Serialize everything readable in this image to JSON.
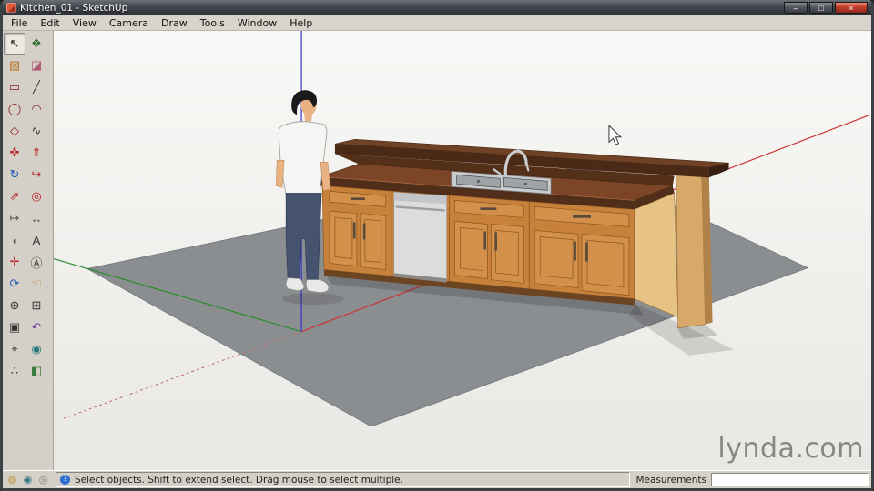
{
  "window": {
    "title": "Kitchen_01 - SketchUp",
    "controls": {
      "minimize_glyph": "–",
      "maximize_glyph": "□",
      "close_glyph": "×"
    }
  },
  "menu": {
    "items": [
      "File",
      "Edit",
      "View",
      "Camera",
      "Draw",
      "Tools",
      "Window",
      "Help"
    ]
  },
  "toolbar": {
    "tools": [
      {
        "id": "select",
        "label": "Select",
        "glyph": "↖",
        "color": "#1a1a1a",
        "active": true
      },
      {
        "id": "make-component",
        "label": "Make Component",
        "glyph": "❖",
        "color": "#2e6b2e",
        "active": false
      },
      {
        "id": "paint-bucket",
        "label": "Paint Bucket",
        "glyph": "▧",
        "color": "#b8762a",
        "active": false
      },
      {
        "id": "eraser",
        "label": "Eraser",
        "glyph": "◪",
        "color": "#b05a7a",
        "active": false
      },
      {
        "id": "rectangle",
        "label": "Rectangle",
        "glyph": "▭",
        "color": "#8a2222",
        "active": false
      },
      {
        "id": "line",
        "label": "Line",
        "glyph": "╱",
        "color": "#333333",
        "active": false
      },
      {
        "id": "circle",
        "label": "Circle",
        "glyph": "◯",
        "color": "#8a2222",
        "active": false
      },
      {
        "id": "arc",
        "label": "Arc",
        "glyph": "◠",
        "color": "#8a2222",
        "active": false
      },
      {
        "id": "polygon",
        "label": "Polygon",
        "glyph": "◇",
        "color": "#8a2222",
        "active": false
      },
      {
        "id": "freehand",
        "label": "Freehand",
        "glyph": "∿",
        "color": "#333333",
        "active": false
      },
      {
        "id": "move",
        "label": "Move",
        "glyph": "✜",
        "color": "#bb2222",
        "active": false
      },
      {
        "id": "push-pull",
        "label": "Push/Pull",
        "glyph": "⇑",
        "color": "#bb2222",
        "active": false
      },
      {
        "id": "rotate",
        "label": "Rotate",
        "glyph": "↻",
        "color": "#2255bb",
        "active": false
      },
      {
        "id": "follow-me",
        "label": "Follow Me",
        "glyph": "↪",
        "color": "#bb2222",
        "active": false
      },
      {
        "id": "scale",
        "label": "Scale",
        "glyph": "⇗",
        "color": "#bb2222",
        "active": false
      },
      {
        "id": "offset",
        "label": "Offset",
        "glyph": "◎",
        "color": "#bb2222",
        "active": false
      },
      {
        "id": "tape-measure",
        "label": "Tape Measure",
        "glyph": "↦",
        "color": "#555555",
        "active": false
      },
      {
        "id": "dimension",
        "label": "Dimension",
        "glyph": "↔",
        "color": "#555555",
        "active": false
      },
      {
        "id": "protractor",
        "label": "Protractor",
        "glyph": "◖",
        "color": "#555555",
        "active": false
      },
      {
        "id": "text",
        "label": "Text",
        "glyph": "A",
        "color": "#333333",
        "active": false
      },
      {
        "id": "axes",
        "label": "Axes",
        "glyph": "✛",
        "color": "#bb2222",
        "active": false
      },
      {
        "id": "3d-text",
        "label": "3D Text",
        "glyph": "Ⓐ",
        "color": "#333333",
        "active": false
      },
      {
        "id": "orbit",
        "label": "Orbit",
        "glyph": "⟳",
        "color": "#2255bb",
        "active": false
      },
      {
        "id": "pan",
        "label": "Pan",
        "glyph": "☜",
        "color": "#b8762a",
        "active": false
      },
      {
        "id": "zoom",
        "label": "Zoom",
        "glyph": "⊕",
        "color": "#333333",
        "active": false
      },
      {
        "id": "zoom-window",
        "label": "Zoom Window",
        "glyph": "⊞",
        "color": "#333333",
        "active": false
      },
      {
        "id": "zoom-extents",
        "label": "Zoom Extents",
        "glyph": "▣",
        "color": "#333333",
        "active": false
      },
      {
        "id": "previous",
        "label": "Previous",
        "glyph": "↶",
        "color": "#6a3fa0",
        "active": false
      },
      {
        "id": "position-camera",
        "label": "Position Camera",
        "glyph": "⌖",
        "color": "#333333",
        "active": false
      },
      {
        "id": "look-around",
        "label": "Look Around",
        "glyph": "◉",
        "color": "#2a7a7a",
        "active": false
      },
      {
        "id": "walk",
        "label": "Walk",
        "glyph": "∴",
        "color": "#333333",
        "active": false
      },
      {
        "id": "section-plane",
        "label": "Section Plane",
        "glyph": "◧",
        "color": "#3a7a3a",
        "active": false
      }
    ]
  },
  "viewport": {
    "watermark": "lynda.com"
  },
  "statusbar": {
    "icons": [
      {
        "name": "geolocation-icon",
        "glyph": "◍",
        "color": "#c2973a"
      },
      {
        "name": "claim-model-icon",
        "glyph": "◉",
        "color": "#3f7d8a"
      },
      {
        "name": "credits-icon",
        "glyph": "◎",
        "color": "#7a7a76"
      }
    ],
    "help_glyph": "?",
    "hint": "Select objects. Shift to extend select. Drag mouse to select multiple.",
    "measurements_label": "Measurements",
    "measurements_value": ""
  },
  "scene": {
    "description": "Kitchen island with wood cabinets, dishwasher and sink; standing male figure; default axes on gray ground plane",
    "colors": {
      "background_top": "#f8f8f6",
      "background_bottom": "#e9e8e4",
      "ground": "#8b8e91",
      "axis_red": "#cc3333",
      "axis_green": "#2a8a2a",
      "axis_blue": "#3333cc",
      "bar_top": "#6f4226",
      "bar_front": "#4a2a16",
      "counter_top": "#7c4527",
      "counter_edge": "#502e19",
      "cabinet_wood": "#c8813a",
      "cabinet_panel": "#d2904a",
      "end_panel": "#e7c286",
      "column": "#d7a868",
      "dishwasher": "#dcdcda",
      "sink_steel": "#9ea3a5",
      "hair": "#1a1a1a",
      "skin": "#e9b283",
      "shirt": "#f5f5f3",
      "jeans": "#46536e",
      "shoes": "#e8e8e6"
    }
  }
}
